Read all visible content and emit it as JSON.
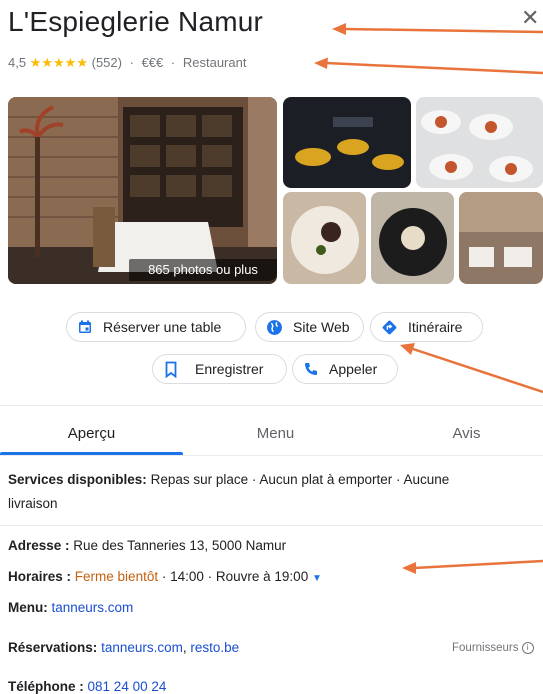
{
  "header": {
    "title": "L'Espieglerie Namur",
    "rating": "4,5",
    "stars": "★★★★★",
    "reviews": "(552)",
    "price": "€€€",
    "category": "Restaurant",
    "dot": "·"
  },
  "photos": {
    "badge": "865 photos ou plus"
  },
  "actions": {
    "reserve": "Réserver une table",
    "website": "Site Web",
    "directions": "Itinéraire",
    "save": "Enregistrer",
    "call": "Appeler"
  },
  "tabs": {
    "overview": "Aperçu",
    "menu": "Menu",
    "reviews": "Avis"
  },
  "info": {
    "services_label": "Services disponibles:",
    "services_value": "Repas sur place · Aucun plat à emporter · Aucune",
    "services_value2": "livraison",
    "address_label": "Adresse :",
    "address_value": "Rue des Tanneries 13, 5000 Namur",
    "hours_label": "Horaires :",
    "hours_status": "Ferme bientôt",
    "hours_detail": "· 14:00 · Rouvre à 19:00",
    "menu_label": "Menu:",
    "menu_link": "tanneurs.com",
    "reservations_label": "Réservations:",
    "reservations_link1": "tanneurs.com",
    "reservations_sep": ",",
    "reservations_link2": "resto.be",
    "providers": "Fournisseurs",
    "phone_label": "Téléphone :",
    "phone_value": "081 24 00 24"
  },
  "colors": {
    "accent": "#1a73e8",
    "star": "#fbbc04",
    "annotation_arrow": "#e8743b",
    "status_orange": "#c5600f"
  }
}
